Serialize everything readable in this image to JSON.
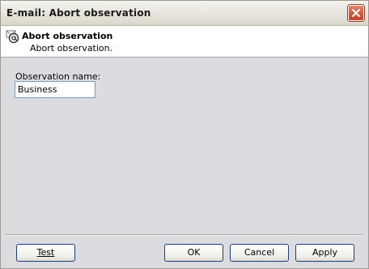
{
  "window": {
    "title": "E-mail: Abort observation"
  },
  "header": {
    "icon": "email-at-icon",
    "title": "Abort observation",
    "subtitle": "Abort observation."
  },
  "form": {
    "observation_name_label": "Observation name:",
    "observation_name_value": "Business"
  },
  "buttons": {
    "test": "Test",
    "ok": "OK",
    "cancel": "Cancel",
    "apply": "Apply"
  },
  "colors": {
    "close_button": "#d4573a",
    "content_bg": "#dcdbe0",
    "button_border": "#1c3f88"
  }
}
